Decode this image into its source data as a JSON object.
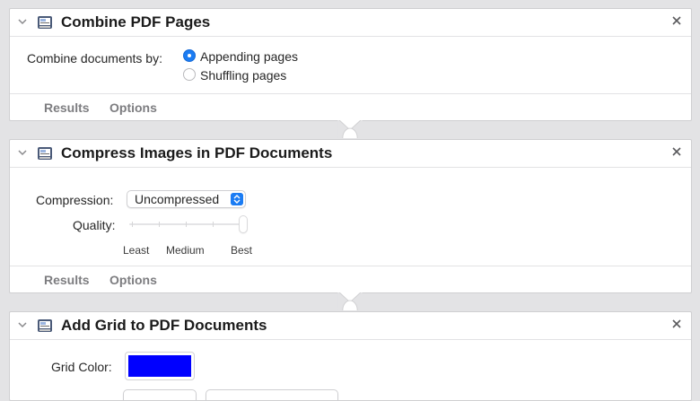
{
  "colors": {
    "accent": "#1b7cf3",
    "grid_color": "#0000ff"
  },
  "actions": [
    {
      "title": "Combine PDF Pages",
      "icon": "pdf-automator-icon",
      "combine_label": "Combine documents by:",
      "options": [
        {
          "label": "Appending pages",
          "selected": true
        },
        {
          "label": "Shuffling pages",
          "selected": false
        }
      ],
      "footer": {
        "results": "Results",
        "options": "Options"
      }
    },
    {
      "title": "Compress Images in PDF Documents",
      "icon": "pdf-automator-icon",
      "compression_label": "Compression:",
      "compression_value": "Uncompressed",
      "quality_label": "Quality:",
      "quality_level": 1.0,
      "quality_ticks": [
        "Least",
        "Medium",
        "Best"
      ],
      "footer": {
        "results": "Results",
        "options": "Options"
      }
    },
    {
      "title": "Add Grid to PDF Documents",
      "icon": "pdf-automator-icon",
      "grid_color_label": "Grid Color:"
    }
  ]
}
